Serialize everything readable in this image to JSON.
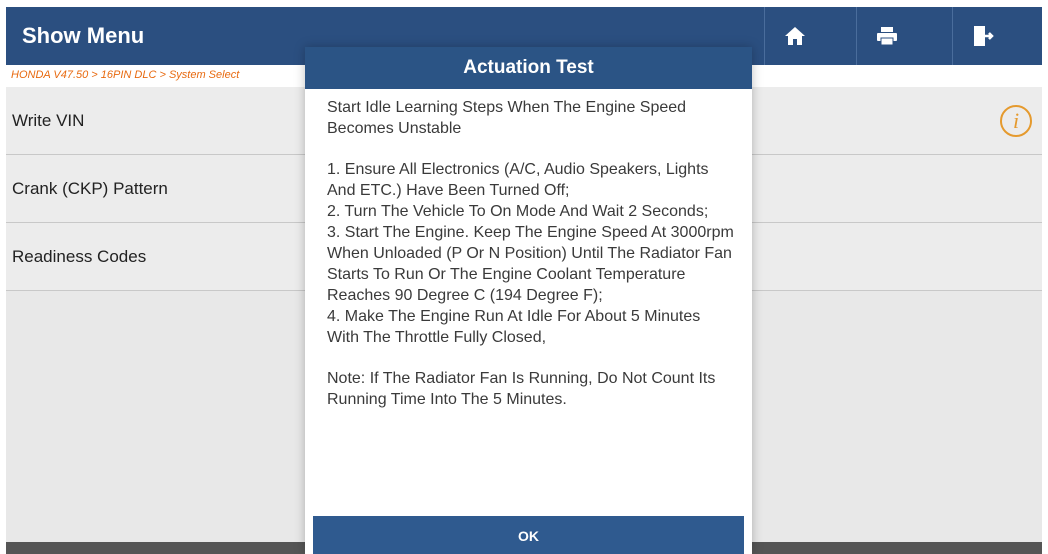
{
  "header": {
    "title": "Show Menu",
    "icons": [
      "home-icon",
      "print-icon",
      "exit-icon"
    ]
  },
  "breadcrumb": "HONDA V47.50 > 16PIN DLC > System Select",
  "list": {
    "items": [
      {
        "label": "Write VIN"
      },
      {
        "label": "Crank (CKP) Pattern"
      },
      {
        "label": "Readiness Codes"
      }
    ],
    "info_icon_text": "i"
  },
  "dialog": {
    "title": "Actuation Test",
    "intro": "Start Idle Learning Steps When The Engine Speed Becomes Unstable",
    "steps": [
      "1. Ensure All Electronics (A/C, Audio Speakers, Lights And ETC.) Have Been Turned Off;",
      "2. Turn The Vehicle To On Mode And Wait 2 Seconds;",
      "3. Start The Engine. Keep The Engine Speed At 3000rpm When Unloaded (P Or N Position) Until The Radiator Fan Starts To Run Or The Engine Coolant Temperature Reaches 90 Degree C (194 Degree F);",
      "4. Make The Engine Run At Idle For About 5 Minutes With The Throttle Fully Closed,"
    ],
    "note": "Note: If The Radiator Fan Is Running, Do Not Count Its Running Time Into The 5 Minutes.",
    "ok_label": "OK"
  },
  "colors": {
    "header_bg": "#2b4f80",
    "breadcrumb_text": "#e86a10",
    "info_icon": "#e59a2e",
    "dialog_header": "#2b5485"
  }
}
